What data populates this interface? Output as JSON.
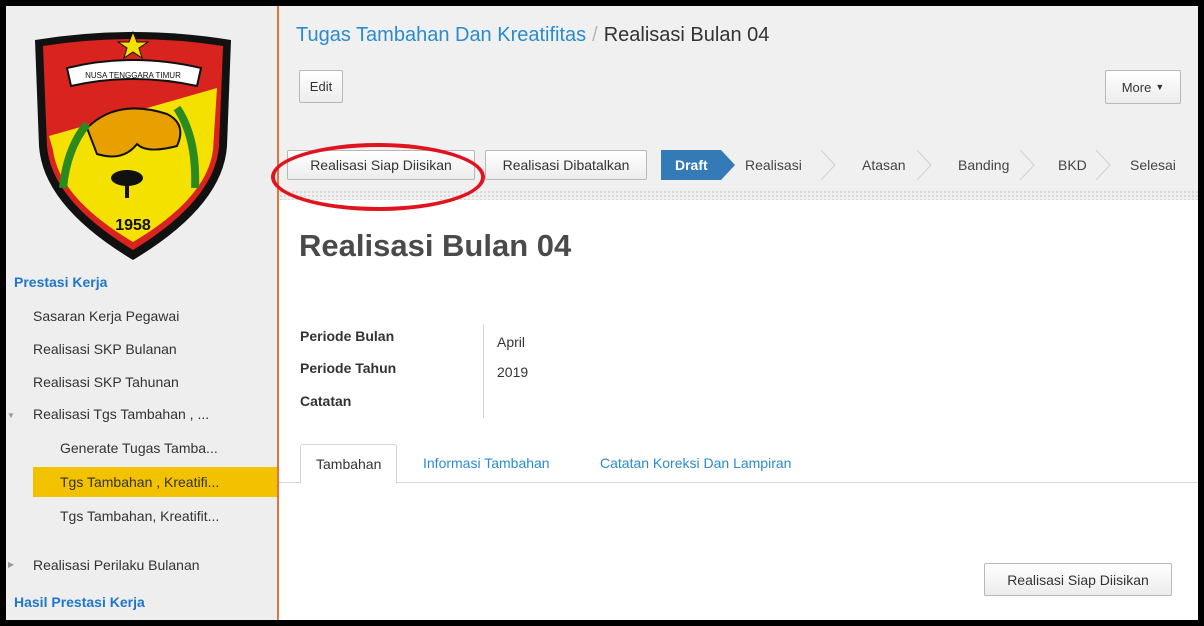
{
  "sidebar": {
    "emblem_text": "NUSA TENGGARA TIMUR",
    "emblem_year": "1958",
    "section_prestasi": "Prestasi Kerja",
    "items": [
      "Sasaran Kerja Pegawai",
      "Realisasi SKP Bulanan",
      "Realisasi SKP Tahunan",
      "Realisasi Tgs Tambahan , ...",
      "Generate Tugas Tamba...",
      "Tgs Tambahan , Kreatifi...",
      "Tgs Tambahan, Kreatifit...",
      "Realisasi Perilaku Bulanan"
    ],
    "section_hasil": "Hasil Prestasi Kerja"
  },
  "header": {
    "breadcrumb_parent": "Tugas Tambahan Dan Kreatifitas",
    "breadcrumb_sep": "/",
    "breadcrumb_current": "Realisasi Bulan 04",
    "edit_label": "Edit",
    "more_label": "More"
  },
  "statusbar": {
    "btn_ready": "Realisasi Siap Diisikan",
    "btn_cancel": "Realisasi Dibatalkan",
    "stages": [
      "Draft",
      "Realisasi",
      "Atasan",
      "Banding",
      "BKD",
      "Selesai"
    ],
    "active_stage": "Draft",
    "active_color": "#337ab7"
  },
  "form": {
    "title": "Realisasi Bulan 04",
    "fields": {
      "periode_bulan_label": "Periode Bulan",
      "periode_bulan_value": "April",
      "periode_tahun_label": "Periode Tahun",
      "periode_tahun_value": "2019",
      "catatan_label": "Catatan"
    },
    "tabs": [
      "Tambahan",
      "Informasi Tambahan",
      "Catatan Koreksi Dan Lampiran"
    ],
    "bottom_button": "Realisasi Siap Diisikan"
  }
}
